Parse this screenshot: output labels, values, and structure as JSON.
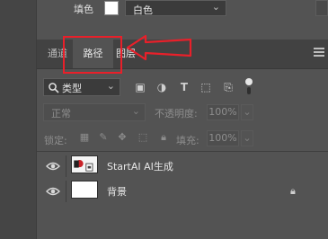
{
  "properties": {
    "fill_label": "填色",
    "fill_color": "#ffffff",
    "fill_value": "白色"
  },
  "tabs": {
    "channels": "通道",
    "paths": "路径",
    "layers": "图层"
  },
  "filter": {
    "kind_label": "类型"
  },
  "blend": {
    "mode": "正常",
    "opacity_label": "不透明度:",
    "opacity_value": "100%"
  },
  "lock": {
    "label": "锁定:",
    "fill_label": "填充:",
    "fill_value": "100%"
  },
  "layers": [
    {
      "name": "StartAI AI生成",
      "visible": true,
      "locked": false
    },
    {
      "name": "背景",
      "visible": true,
      "locked": true
    }
  ],
  "annotation": {
    "highlight_color": "#e8202a"
  }
}
